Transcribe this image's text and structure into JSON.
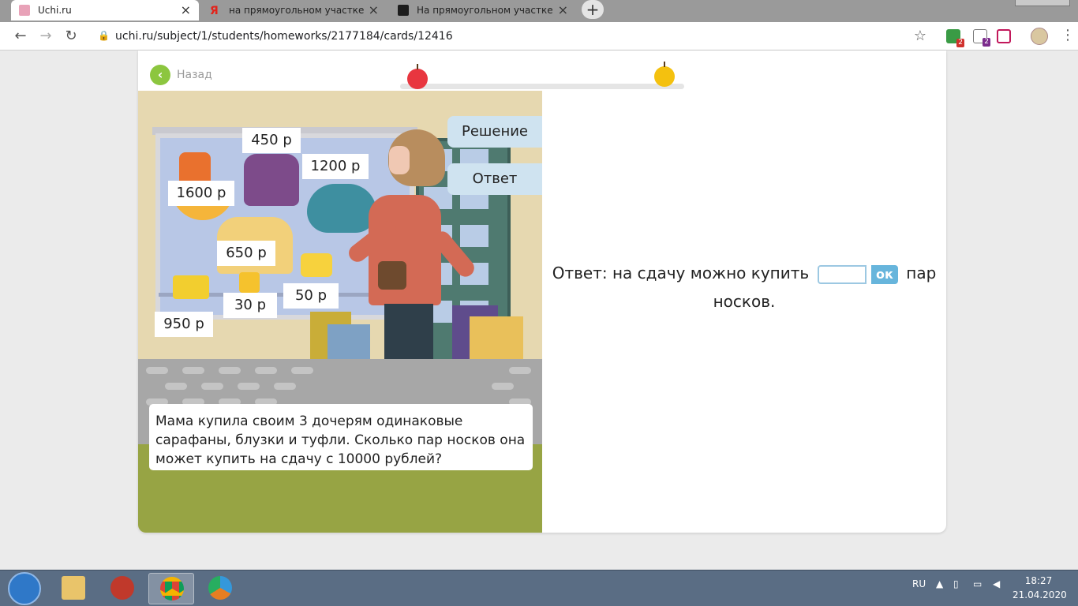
{
  "browser": {
    "tabs": [
      {
        "title": "Uchi.ru",
        "active": true
      },
      {
        "title": "на прямоугольном участке постро",
        "active": false
      },
      {
        "title": "На прямоугольном участке постро",
        "active": false
      }
    ],
    "new_tab_label": "+",
    "close_glyph": "×",
    "url": "uchi.ru/subject/1/students/homeworks/2177184/cards/12416",
    "extension_badges": [
      "2",
      "2"
    ]
  },
  "page": {
    "back_label": "Назад",
    "scene_prices": {
      "dress": "1600 р",
      "vest": "450 р",
      "skirt": "1200 р",
      "blouse": "650 р",
      "bow": "30 р",
      "socks": "50 р",
      "shoes": "950 р"
    },
    "side_tabs": {
      "solution": "Решение",
      "answer": "Ответ"
    },
    "story": "Мама купила своим 3 дочерям одинаковые сарафаны, блузки и туфли. Сколько пар носков она может купить на сдачу с 10000 рублей?",
    "answer": {
      "prefix": "Ответ: на сдачу можно купить",
      "input_value": "",
      "ok_label": "ок",
      "suffix_1": "пар",
      "suffix_2": "носков."
    }
  },
  "taskbar": {
    "language": "RU",
    "time": "18:27",
    "date": "21.04.2020"
  },
  "colors": {
    "brand_green": "#8cc63f",
    "accent_blue": "#67b5dc",
    "side_tab_bg": "#cfe3f0",
    "grass": "#97a444"
  }
}
